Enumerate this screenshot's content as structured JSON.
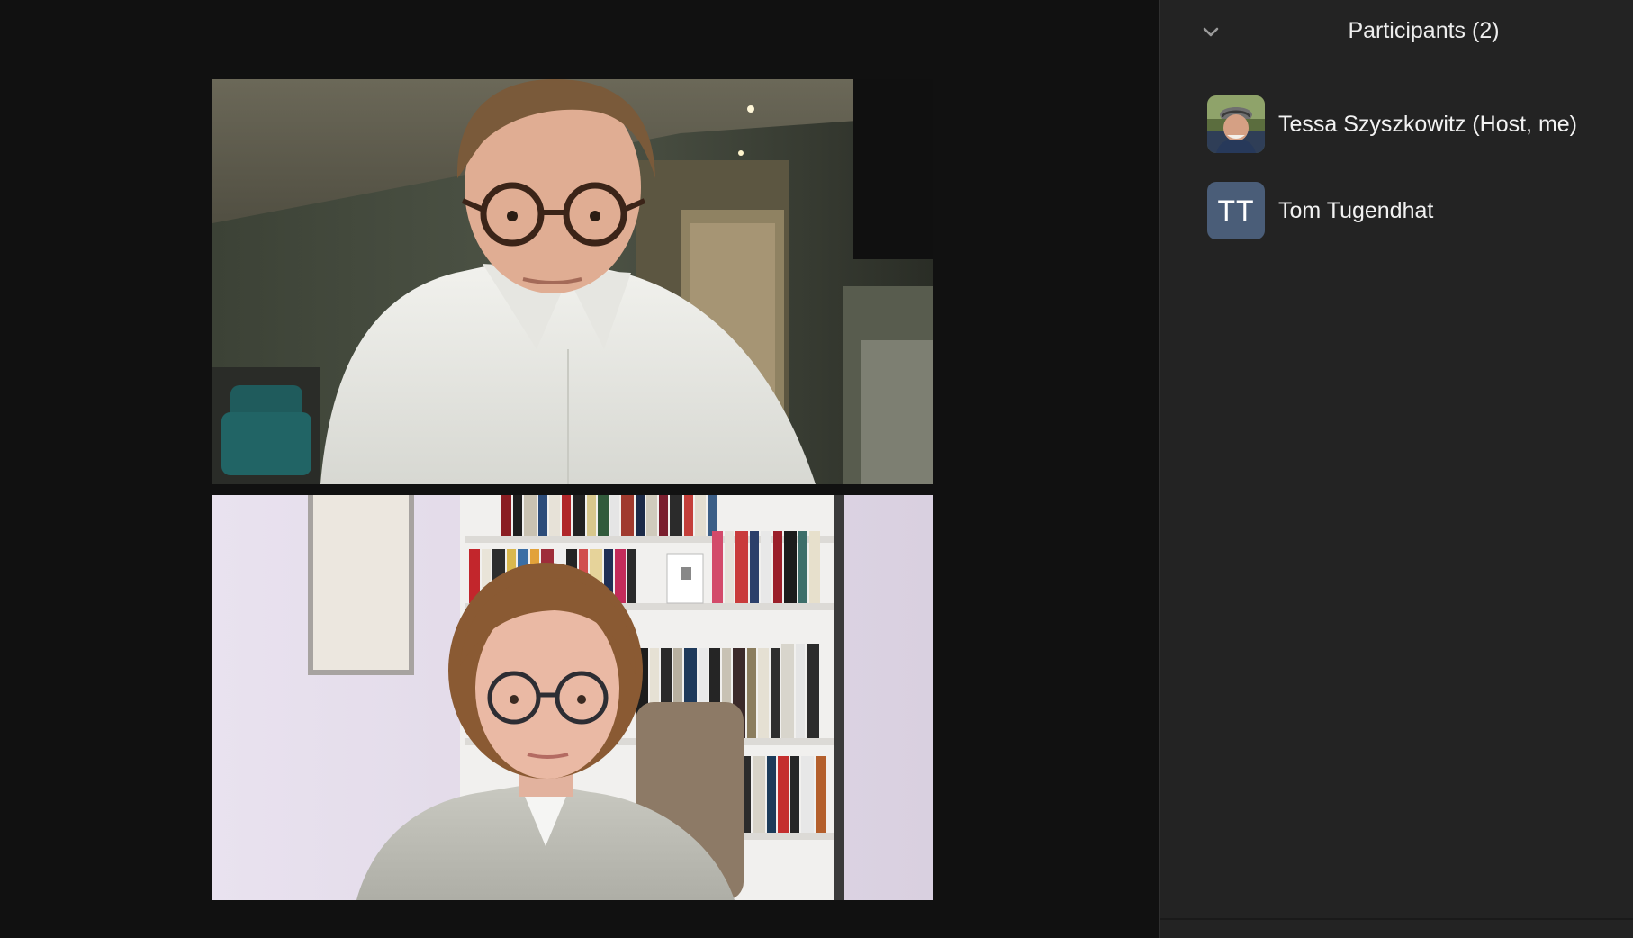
{
  "gallery": {
    "tiles": [
      {
        "participant": "Tom Tugendhat"
      },
      {
        "participant": "Tessa Szyszkowitz"
      }
    ]
  },
  "participants_panel": {
    "title": "Participants (2)",
    "collapse_icon": "chevron-down-icon",
    "participants": [
      {
        "name": "Tessa Szyszkowitz (Host, me)",
        "avatar": "photo"
      },
      {
        "name": "Tom Tugendhat",
        "avatar": "initials",
        "initials": "TT",
        "avatar_color": "#4a5d78"
      }
    ]
  },
  "colors": {
    "gallery_background": "#111111",
    "panel_background": "#232323",
    "text": "#f2f2f2"
  }
}
